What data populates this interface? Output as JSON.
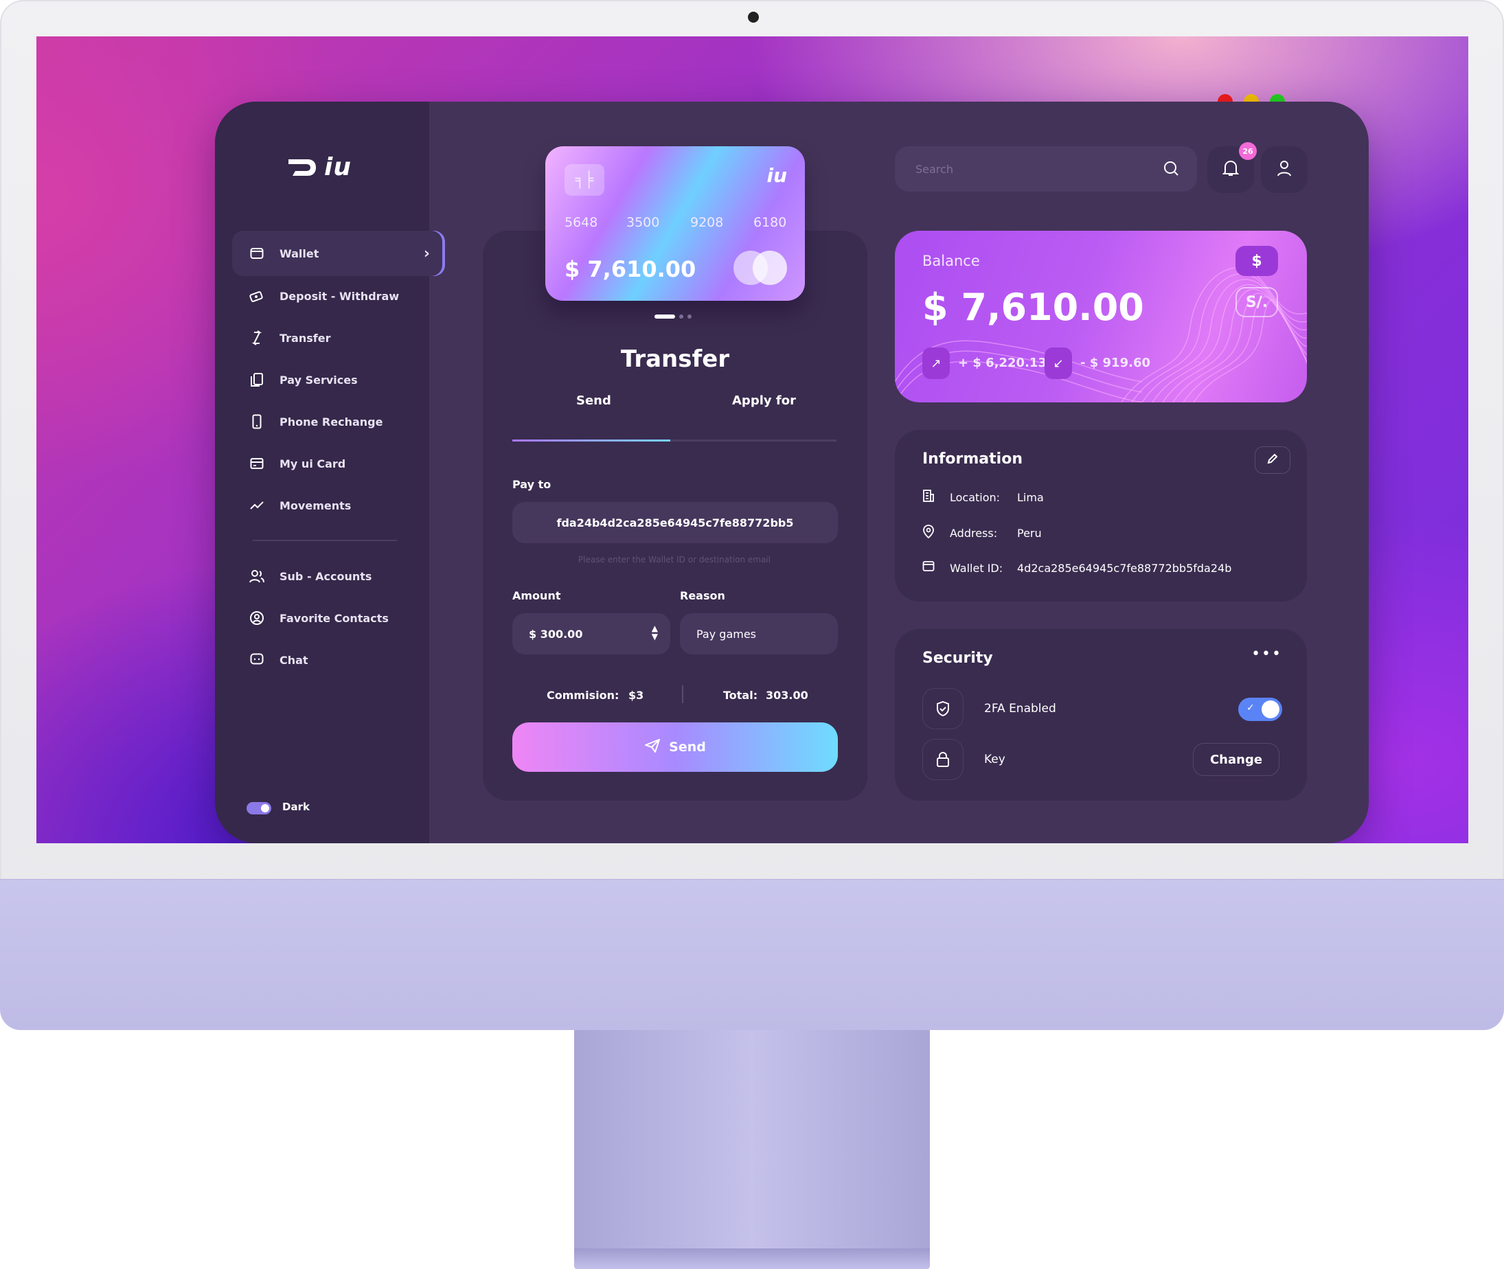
{
  "brand": {
    "name": "iu"
  },
  "sidebar": {
    "items": [
      {
        "label": "Wallet",
        "icon": "wallet-icon"
      },
      {
        "label": "Deposit - Withdraw",
        "icon": "cash-icon"
      },
      {
        "label": "Transfer",
        "icon": "transfer-icon"
      },
      {
        "label": "Pay Services",
        "icon": "bill-icon"
      },
      {
        "label": "Phone Rechange",
        "icon": "phone-icon"
      },
      {
        "label": "My ui Card",
        "icon": "card-icon"
      },
      {
        "label": "Movements",
        "icon": "trend-icon"
      },
      {
        "label": "Sub - Accounts",
        "icon": "users-icon"
      },
      {
        "label": "Favorite Contacts",
        "icon": "contacts-icon"
      },
      {
        "label": "Chat",
        "icon": "chat-icon"
      }
    ],
    "theme_label": "Dark"
  },
  "card": {
    "numbers": [
      "5648",
      "3500",
      "9208",
      "6180"
    ],
    "balance": "$ 7,610.00"
  },
  "transfer": {
    "title": "Transfer",
    "tabs": [
      "Send",
      "Apply for"
    ],
    "pay_to_label": "Pay to",
    "pay_to_value": "fda24b4d2ca285e64945c7fe88772bb5",
    "hint": "Please enter the Wallet ID or destination email",
    "amount_label": "Amount",
    "amount_value": "$ 300.00",
    "reason_label": "Reason",
    "reason_value": "Pay games",
    "commission_label": "Commision:",
    "commission_value": "$3",
    "total_label": "Total:",
    "total_value": "303.00",
    "send_label": "Send"
  },
  "header": {
    "search_placeholder": "Search",
    "notifications": "26"
  },
  "balance": {
    "title": "Balance",
    "amount": "$ 7,610.00",
    "currencies": [
      "$",
      "S/."
    ],
    "income": "+ $ 6,220.13",
    "expense": "- $ 919.60"
  },
  "information": {
    "title": "Information",
    "rows": [
      {
        "key": "Location:",
        "value": "Lima"
      },
      {
        "key": "Address:",
        "value": "Peru"
      },
      {
        "key": "Wallet ID:",
        "value": "4d2ca285e64945c7fe88772bb5fda24b"
      }
    ]
  },
  "security": {
    "title": "Security",
    "twofa_label": "2FA Enabled",
    "twofa_enabled": true,
    "key_label": "Key",
    "change_label": "Change"
  },
  "colors": {
    "accent": "#8c79e8",
    "app_bg": "#433358",
    "sidebar_bg": "#35284a",
    "panel_bg": "#3a2c4f"
  }
}
